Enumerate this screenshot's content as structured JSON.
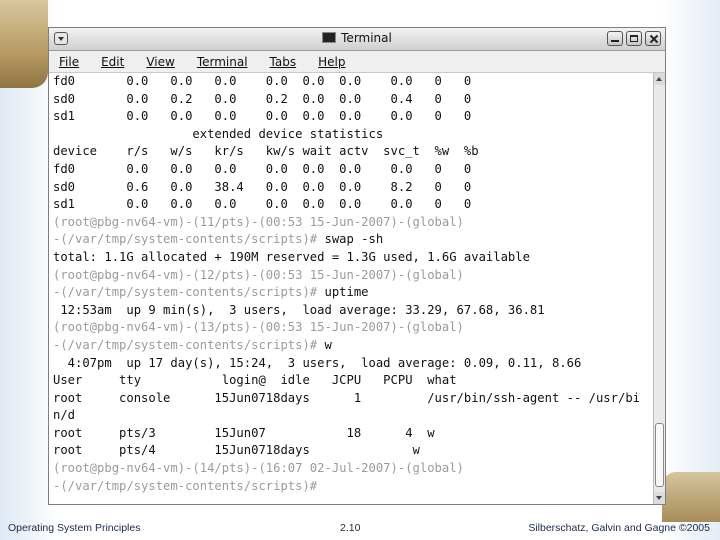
{
  "window": {
    "title": "Terminal"
  },
  "menu": {
    "items": [
      {
        "label": "File"
      },
      {
        "label": "Edit"
      },
      {
        "label": "View"
      },
      {
        "label": "Terminal"
      },
      {
        "label": "Tabs"
      },
      {
        "label": "Help"
      }
    ]
  },
  "terminal": {
    "lines": [
      {
        "text": "fd0       0.0   0.0   0.0    0.0  0.0  0.0    0.0   0   0"
      },
      {
        "text": "sd0       0.0   0.2   0.0    0.2  0.0  0.0    0.4   0   0"
      },
      {
        "text": "sd1       0.0   0.0   0.0    0.0  0.0  0.0    0.0   0   0"
      },
      {
        "text": "                   extended device statistics"
      },
      {
        "text": "device    r/s   w/s   kr/s   kw/s wait actv  svc_t  %w  %b"
      },
      {
        "text": "fd0       0.0   0.0   0.0    0.0  0.0  0.0    0.0   0   0"
      },
      {
        "text": "sd0       0.6   0.0   38.4   0.0  0.0  0.0    8.2   0   0"
      },
      {
        "text": "sd1       0.0   0.0   0.0    0.0  0.0  0.0    0.0   0   0"
      },
      {
        "prompt": "(root@pbg-nv64-vm)-(11/pts)-(00:53 15-Jun-2007)-(global)",
        "text": ""
      },
      {
        "prompt": "-(/var/tmp/system-contents/scripts)#",
        "text": " swap -sh"
      },
      {
        "text": "total: 1.1G allocated + 190M reserved = 1.3G used, 1.6G available"
      },
      {
        "prompt": "(root@pbg-nv64-vm)-(12/pts)-(00:53 15-Jun-2007)-(global)",
        "text": ""
      },
      {
        "prompt": "-(/var/tmp/system-contents/scripts)#",
        "text": " uptime"
      },
      {
        "text": " 12:53am  up 9 min(s),  3 users,  load average: 33.29, 67.68, 36.81"
      },
      {
        "prompt": "(root@pbg-nv64-vm)-(13/pts)-(00:53 15-Jun-2007)-(global)",
        "text": ""
      },
      {
        "prompt": "-(/var/tmp/system-contents/scripts)#",
        "text": " w"
      },
      {
        "text": "  4:07pm  up 17 day(s), 15:24,  3 users,  load average: 0.09, 0.11, 8.66"
      },
      {
        "text": "User     tty           login@  idle   JCPU   PCPU  what"
      },
      {
        "text": "root     console      15Jun0718days      1         /usr/bin/ssh-agent -- /usr/bi"
      },
      {
        "text": "n/d"
      },
      {
        "text": "root     pts/3        15Jun07           18      4  w"
      },
      {
        "text": "root     pts/4        15Jun0718days              w"
      },
      {
        "prompt": "(root@pbg-nv64-vm)-(14/pts)-(16:07 02-Jul-2007)-(global)",
        "text": ""
      },
      {
        "prompt": "-(/var/tmp/system-contents/scripts)#",
        "text": ""
      }
    ]
  },
  "footer": {
    "left": "Operating System Principles",
    "center": "2.10",
    "right": "Silberschatz, Galvin and Gagne ©2005"
  },
  "colors": {
    "prompt": "#9b9b9b",
    "text": "#111111"
  }
}
